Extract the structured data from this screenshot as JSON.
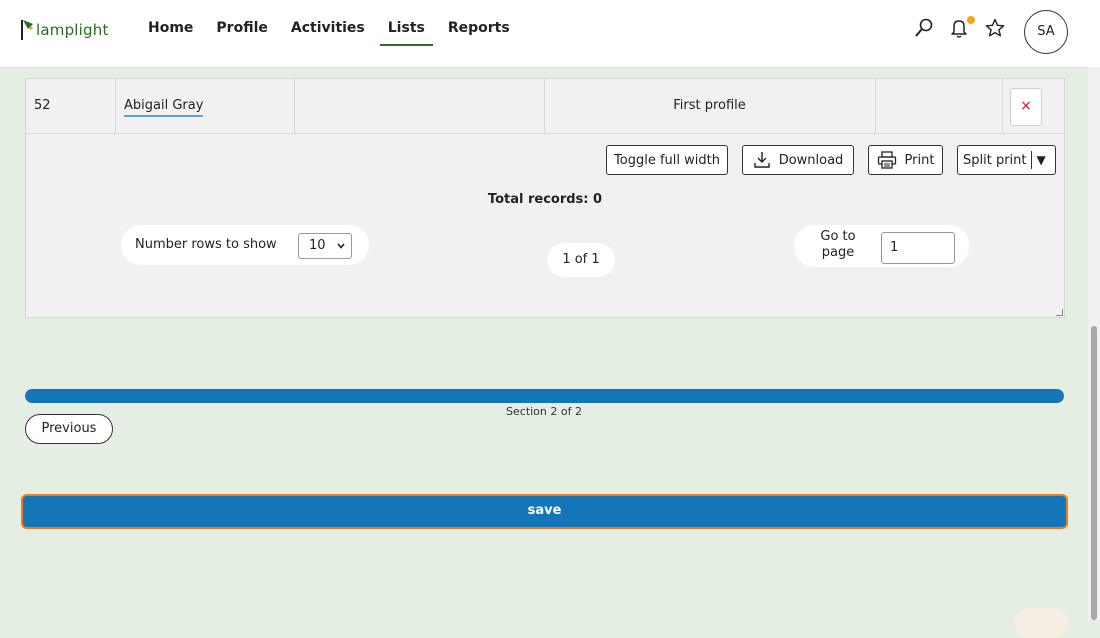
{
  "header": {
    "logo_text": "lamplight",
    "nav": [
      {
        "label": "Home"
      },
      {
        "label": "Profile"
      },
      {
        "label": "Activities"
      },
      {
        "label": "Lists"
      },
      {
        "label": "Reports"
      }
    ],
    "active_nav": "Lists",
    "icons": [
      "search-icon",
      "bell-icon",
      "star-icon"
    ],
    "avatar_initials": "SA"
  },
  "table": {
    "row": {
      "id": "52",
      "name": "Abigail Gray",
      "type": "First profile",
      "delete_symbol": "×"
    },
    "toolbar": {
      "toggle_label": "Toggle full width",
      "download_label": "Download",
      "print_label": "Print",
      "split_print_label": "Split print",
      "split_arrow": "▼"
    },
    "total_records": "Total records: 0",
    "rows_label": "Number rows to show",
    "rows_value": "10",
    "page_indicator": "1 of 1",
    "goto_label_1": "Go to",
    "goto_label_2": "page",
    "goto_value": "1"
  },
  "progress": {
    "fraction": 1.0,
    "section_text": "Section 2 of 2"
  },
  "buttons": {
    "previous_label": "Previous",
    "save_label": "save"
  },
  "colors": {
    "brand_green": "#2f6b25",
    "primary_blue": "#1476b9",
    "focus_orange": "#f07b1a",
    "notification_dot": "#f3a712",
    "page_background": "#e4eee2"
  }
}
